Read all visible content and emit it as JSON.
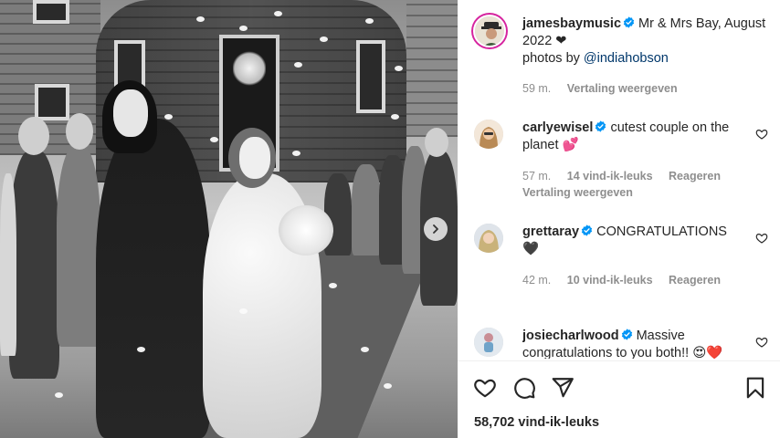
{
  "post": {
    "author": "jamesbaymusic",
    "caption_text": "Mr & Mrs Bay, August 2022",
    "caption_emoji": "❤",
    "photos_by_prefix": "photos by ",
    "photos_by_handle": "@indiahobson",
    "time": "59 m.",
    "translate_label": "Vertaling weergeven",
    "likes": "58,702 vind-ik-leuks"
  },
  "comments": [
    {
      "username": "carlyewisel",
      "text": "cutest couple on the planet",
      "emoji": "💕",
      "time": "57 m.",
      "likes": "14 vind-ik-leuks",
      "reply_label": "Reageren",
      "translate_label": "Vertaling weergeven"
    },
    {
      "username": "grettaray",
      "text": "CONGRATULATIONS",
      "emoji": "🖤",
      "time": "42 m.",
      "likes": "10 vind-ik-leuks",
      "reply_label": "Reageren"
    },
    {
      "username": "josiecharlwood",
      "text": "Massive congratulations to you both!!",
      "emoji": "😍❤️"
    }
  ],
  "colors": {
    "verified": "#0095f6",
    "text": "#262626",
    "muted": "#8e8e8e",
    "link": "#00376b",
    "story_ring": "#d6249f"
  },
  "icons": {
    "like": "heart-icon",
    "comment": "comment-bubble-icon",
    "share": "paper-plane-icon",
    "save": "bookmark-icon",
    "next": "chevron-right-icon"
  }
}
